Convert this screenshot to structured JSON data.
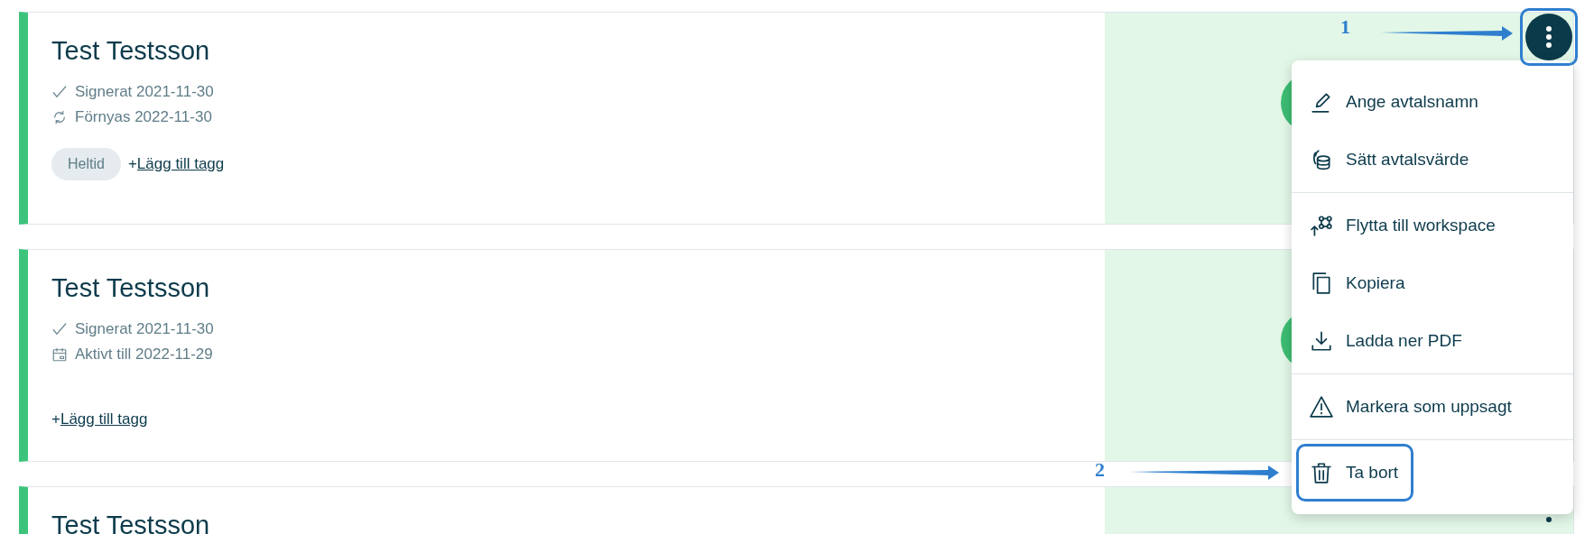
{
  "cards": [
    {
      "title": "Test Testsson",
      "menu_open": true,
      "kebab_annotated": true,
      "lines": [
        {
          "kind": "check",
          "text": "Signerat 2021-11-30"
        },
        {
          "kind": "renew",
          "text": "Förnyas 2022-11-30"
        }
      ],
      "tags": [
        "Heltid"
      ],
      "add_tag": {
        "sign": "+",
        "label": "Lägg till tagg"
      }
    },
    {
      "title": "Test Testsson",
      "lines": [
        {
          "kind": "check",
          "text": "Signerat 2021-11-30"
        },
        {
          "kind": "calendar",
          "text": "Aktivt till 2022-11-29"
        }
      ],
      "add_tag": {
        "sign": "+",
        "label": "Lägg till tagg"
      }
    },
    {
      "title": "Test Testsson",
      "menu_open": false,
      "kebab_annotated": false
    }
  ],
  "menu": {
    "groups": [
      [
        {
          "kind": "pen",
          "label": "Ange avtalsnamn",
          "annotated": false
        },
        {
          "kind": "coins",
          "label": "Sätt avtalsvärde",
          "annotated": false
        }
      ],
      [
        {
          "kind": "move",
          "label": "Flytta till workspace",
          "annotated": false
        },
        {
          "kind": "copy",
          "label": "Kopiera",
          "annotated": false
        },
        {
          "kind": "download",
          "label": "Ladda ner PDF",
          "annotated": false
        }
      ],
      [
        {
          "kind": "warning",
          "label": "Markera som uppsagt",
          "annotated": false
        }
      ],
      [
        {
          "kind": "trash",
          "label": "Ta bort",
          "annotated": true
        }
      ]
    ]
  },
  "annotations": [
    {
      "label": "1"
    },
    {
      "label": "2"
    }
  ]
}
